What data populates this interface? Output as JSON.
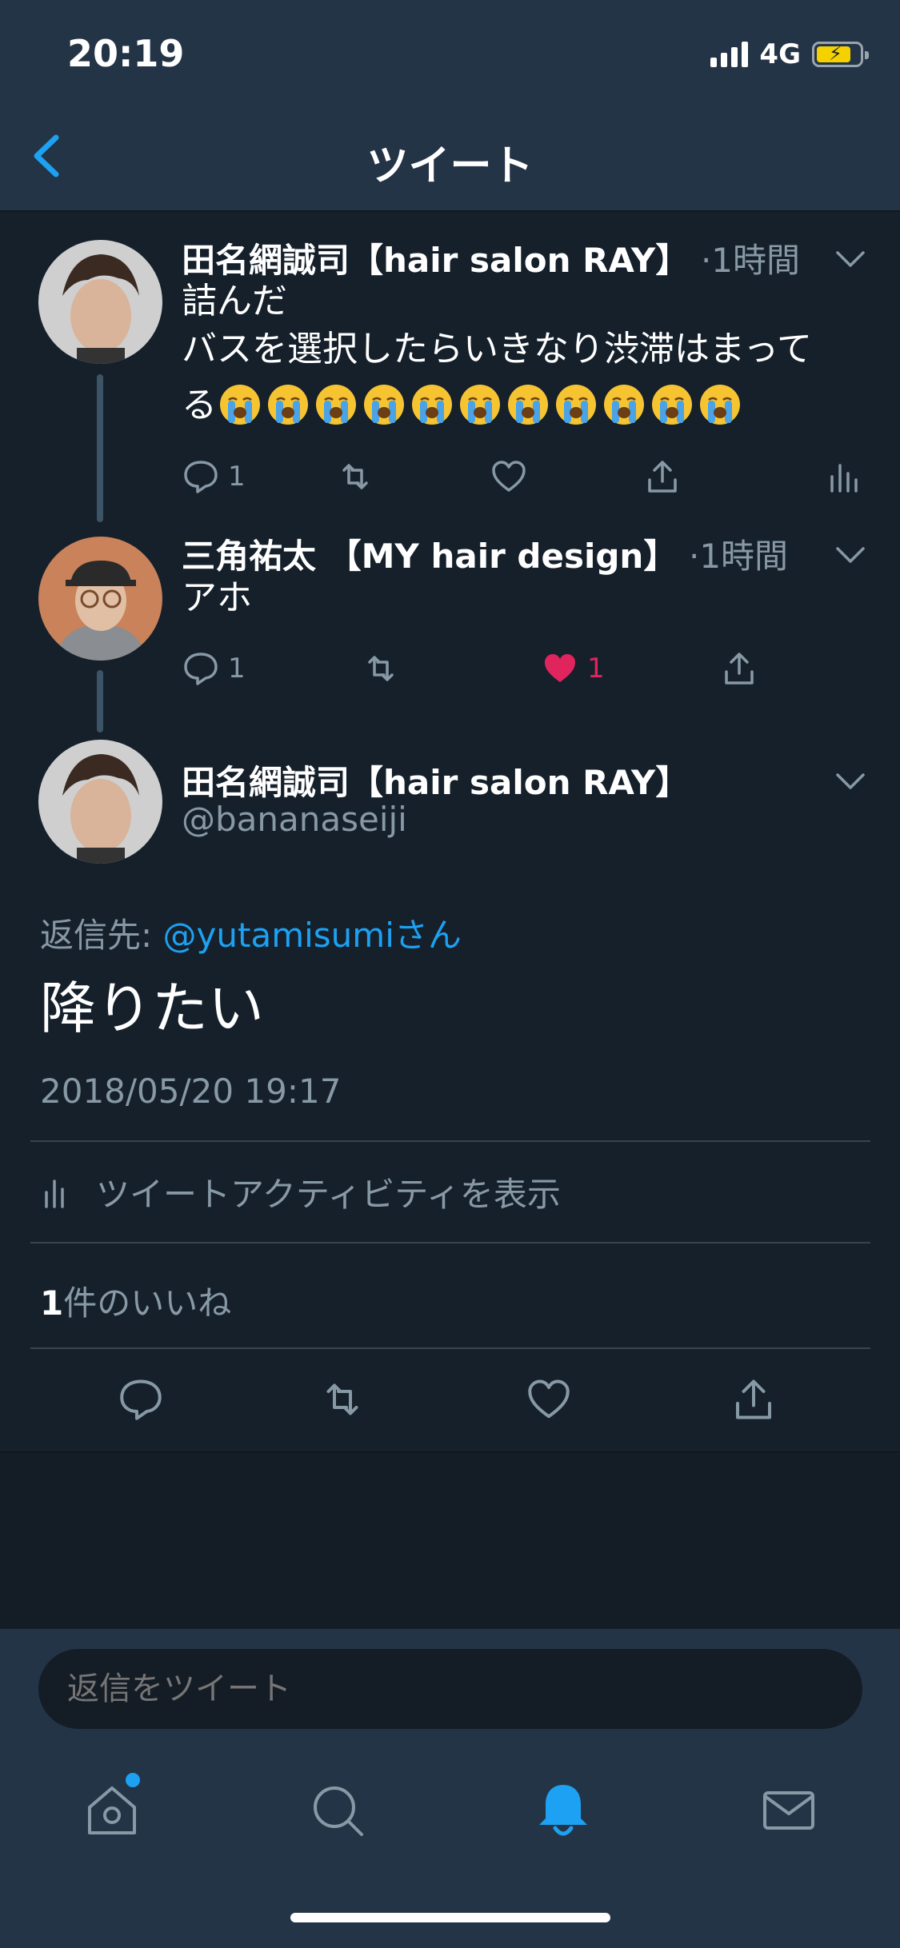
{
  "status": {
    "time": "20:19",
    "network": "4G"
  },
  "nav": {
    "title": "ツイート"
  },
  "tweets": [
    {
      "name": "田名網誠司【hair salon RAY】",
      "meta": "·1時間",
      "text_line1": "詰んだ",
      "text_line2": "バスを選択したらいきなり渋滞はまって",
      "text_line3": "る",
      "emoji": "loudly-crying-face",
      "emoji_count": 11,
      "reply_count": "1"
    },
    {
      "name": "三角祐太 【MY hair design】",
      "meta": "·1時間",
      "text_line1": "アホ",
      "reply_count": "1",
      "like_count": "1"
    }
  ],
  "main_tweet": {
    "name": "田名網誠司【hair salon RAY】",
    "handle": "@bananaseiji",
    "reply_to_label": "返信先: ",
    "reply_to_user": "@yutamisumiさん",
    "text": "降りたい",
    "timestamp": "2018/05/20 19:17",
    "activity_label": "ツイートアクティビティを表示",
    "likes_count": "1",
    "likes_label": "件のいいね"
  },
  "reply": {
    "placeholder": "返信をツイート"
  },
  "colors": {
    "background": "#15202b",
    "bar": "#243447",
    "accent": "#1da1f2",
    "like": "#e0245e",
    "muted": "#8899a6"
  },
  "icons": [
    "back-chevron-icon",
    "reply-icon",
    "retweet-icon",
    "heart-icon",
    "share-icon",
    "analytics-icon",
    "home-icon",
    "search-icon",
    "notifications-icon",
    "messages-icon"
  ]
}
